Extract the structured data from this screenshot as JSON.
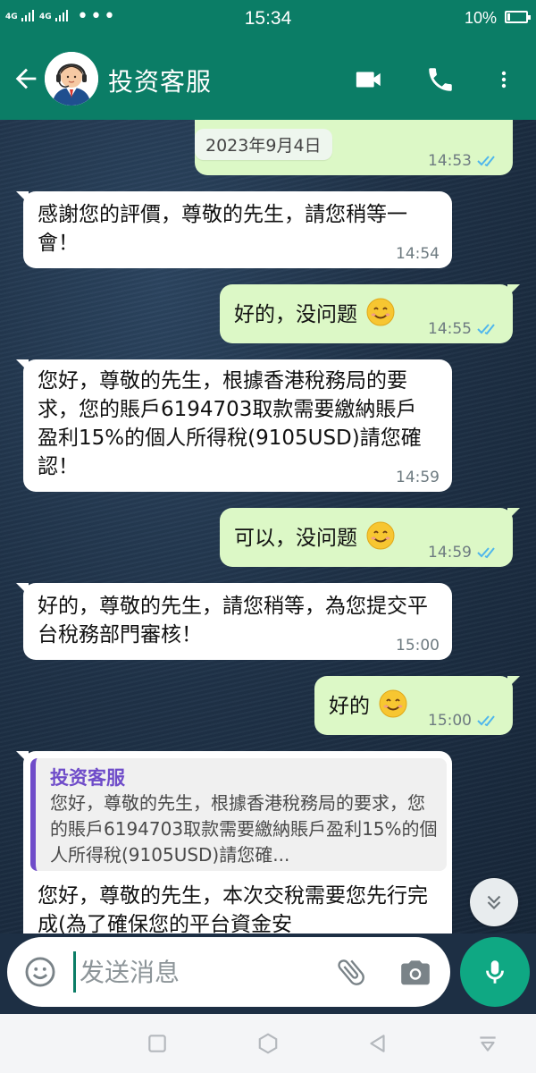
{
  "status_bar": {
    "signal1": "4G",
    "signal2": "4G",
    "dots": "•••",
    "time": "15:34",
    "battery_percent": "10%",
    "battery_level": 0.1
  },
  "header": {
    "contact_name": "投资客服"
  },
  "chat": {
    "date_chip": "2023年9月4日",
    "messages": [
      {
        "direction": "out",
        "text": "",
        "time": "14:53",
        "read": true
      },
      {
        "direction": "in",
        "text": "感謝您的評價，尊敬的先生，請您稍等一會！",
        "time": "14:54"
      },
      {
        "direction": "out",
        "text": "好的，没问题",
        "emoji": "smiling-face",
        "time": "14:55",
        "read": true
      },
      {
        "direction": "in",
        "text": "您好，尊敬的先生，根據香港稅務局的要求，您的賬戶6194703取款需要繳納賬戶盈利15%的個人所得稅(9105USD)請您確認！",
        "time": "14:59"
      },
      {
        "direction": "out",
        "text": "可以，没问题",
        "emoji": "smiling-face",
        "time": "14:59",
        "read": true
      },
      {
        "direction": "in",
        "text": "好的，尊敬的先生，請您稍等，為您提交平台稅務部門審核！",
        "time": "15:00"
      },
      {
        "direction": "out",
        "text": "好的",
        "emoji": "smiling-face",
        "time": "15:00",
        "read": true
      },
      {
        "direction": "in",
        "quote_name": "投资客服",
        "quote_text": "您好，尊敬的先生，根據香港稅務局的要求，您的賬戶6194703取款需要繳納賬戶盈利15%的個人所得稅(9105USD)請您確...",
        "text": "您好，尊敬的先生，本次交稅需要您先行完成(為了確保您的平台資金安"
      }
    ]
  },
  "composer": {
    "placeholder": "发送消息"
  },
  "colors": {
    "header": "#0b7d66",
    "outgoing_bubble": "#dcf8c6",
    "incoming_bubble": "#ffffff",
    "read_ticks": "#4fb6ec",
    "quote_accent": "#6f4cc9",
    "mic_button": "#0fa883"
  },
  "icons": [
    "back-arrow-icon",
    "video-call-icon",
    "phone-icon",
    "more-vert-icon",
    "emoji-icon",
    "attach-icon",
    "camera-icon",
    "mic-icon",
    "chevron-double-down-icon",
    "nav-recents-icon",
    "nav-home-icon",
    "nav-back-icon",
    "nav-menu-icon"
  ]
}
